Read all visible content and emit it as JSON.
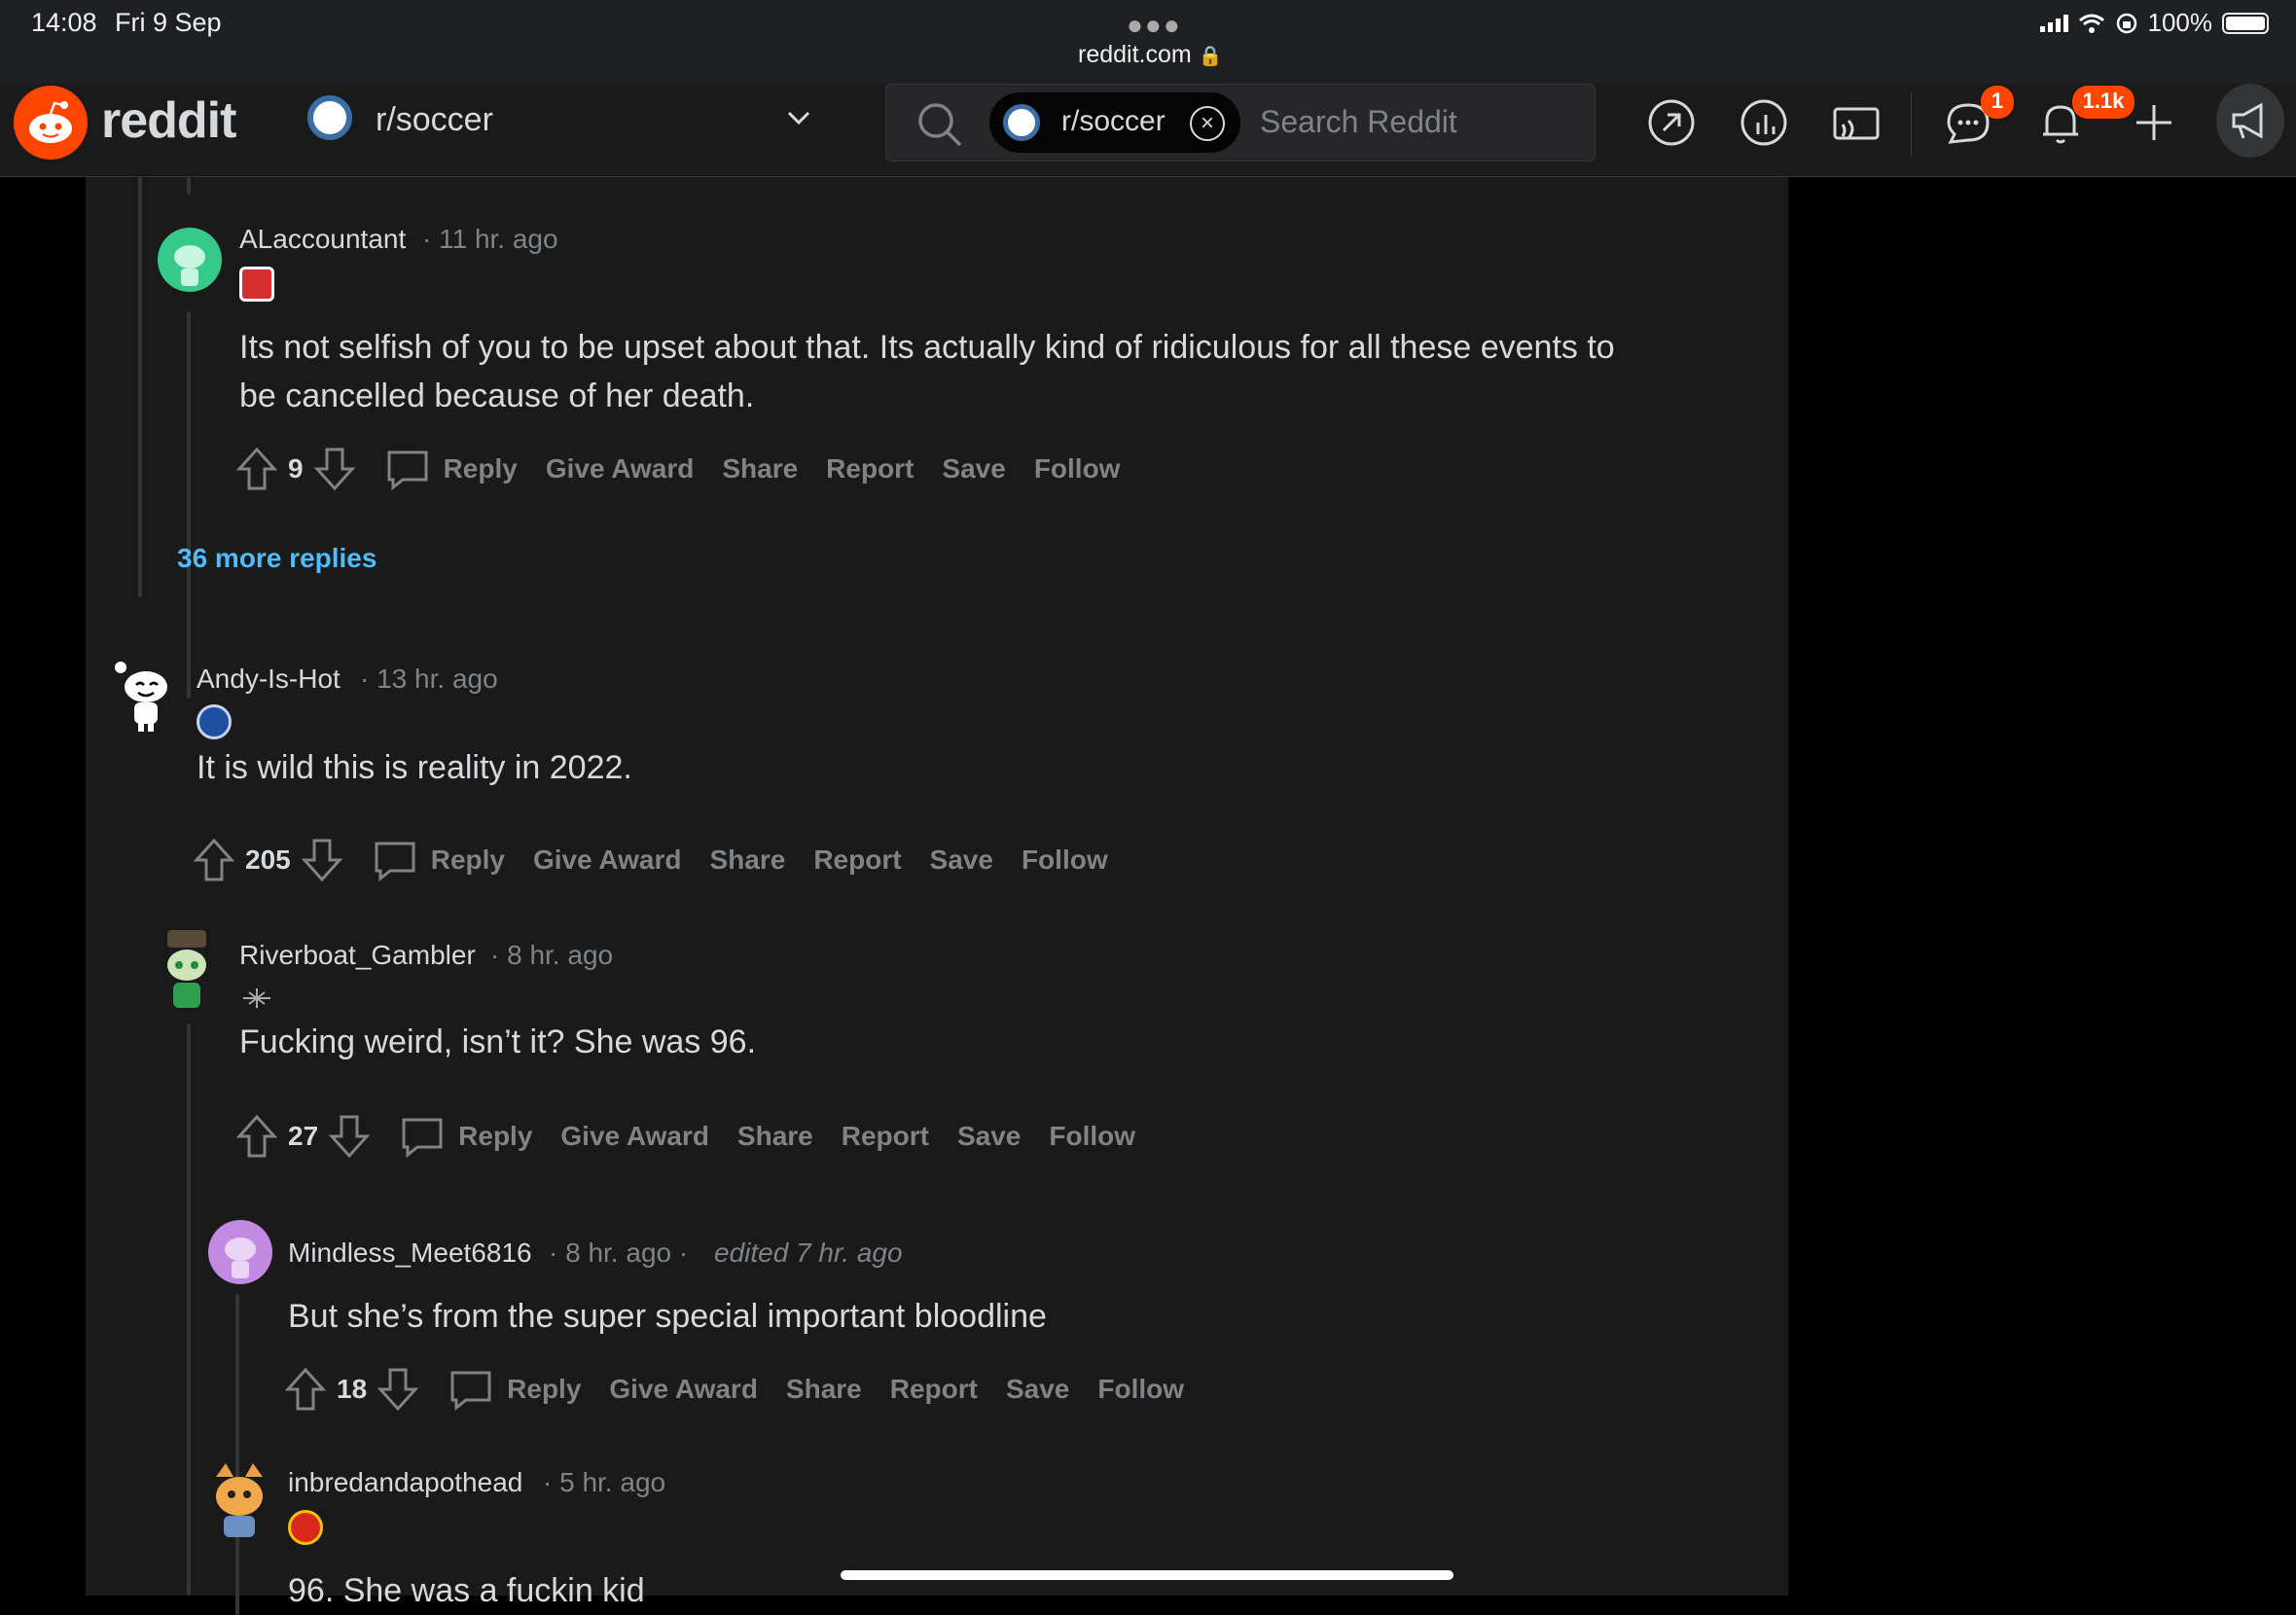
{
  "status_bar": {
    "time": "14:08",
    "date": "Fri 9 Sep",
    "battery": "100%",
    "url": "reddit.com"
  },
  "header": {
    "logo_text": "reddit",
    "subreddit": "r/soccer",
    "search_chip": "r/soccer",
    "search_placeholder": "Search Reddit",
    "chat_badge": "1",
    "notifications_badge": "1.1k"
  },
  "colors": {
    "accent": "#ff4500",
    "link": "#4fbcff",
    "background": "#1a1a1b"
  },
  "actions": {
    "reply": "Reply",
    "give_award": "Give Award",
    "share": "Share",
    "report": "Report",
    "save": "Save",
    "follow": "Follow"
  },
  "more_replies": "36 more replies",
  "comments": [
    {
      "author": "ALaccountant",
      "time": "· 11 hr. ago",
      "body": "Its not selfish of you to be upset about that. Its actually kind of ridiculous for all these events to be cancelled because of her death.",
      "votes": "9"
    },
    {
      "author": "Andy-Is-Hot",
      "time": "· 13 hr. ago",
      "body": "It is wild this is reality in 2022.",
      "votes": "205"
    },
    {
      "author": "Riverboat_Gambler",
      "time": "· 8 hr. ago",
      "body": "Fucking weird, isn’t it? She was 96.",
      "votes": "27"
    },
    {
      "author": "Mindless_Meet6816",
      "time": "· 8 hr. ago ·",
      "edited": "edited 7 hr. ago",
      "body": "But she’s from the super special important bloodline",
      "votes": "18"
    },
    {
      "author": "inbredandapothead",
      "time": "· 5 hr. ago",
      "body": "96. She was a fuckin kid"
    }
  ]
}
